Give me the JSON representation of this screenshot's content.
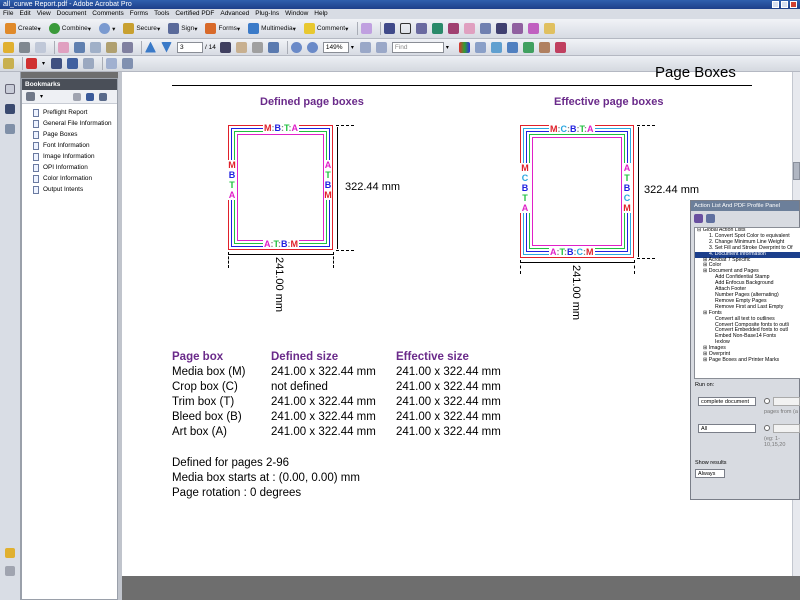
{
  "window": {
    "title": "all_curwe Report.pdf - Adobe Acrobat Pro"
  },
  "menu": [
    "File",
    "Edit",
    "View",
    "Document",
    "Comments",
    "Forms",
    "Tools",
    "Certified PDF",
    "Advanced",
    "Plug-Ins",
    "Window",
    "Help"
  ],
  "toolbar": {
    "create": "Create",
    "combine": "Combine",
    "secure": "Secure",
    "sign": "Sign",
    "forms": "Forms",
    "multimedia": "Multimedia",
    "comment": "Comment",
    "page_number": "3",
    "page_total": "/ 14",
    "zoom": "149%",
    "find_placeholder": "Find"
  },
  "bookmarks": {
    "title": "Bookmarks",
    "items": [
      "Preflight Report",
      "General File Information",
      "Page Boxes",
      "Font Information",
      "Image Information",
      "OPI Information",
      "Color Information",
      "Output Intents"
    ]
  },
  "page": {
    "heading": "Page Boxes",
    "defined_caption": "Defined page boxes",
    "effective_caption": "Effective page boxes",
    "height_dim": "322.44 mm",
    "width_dim": "241.00 mm",
    "defined_top_labels": [
      "M",
      "B",
      "T",
      "A"
    ],
    "defined_left_labels": [
      "M",
      "B",
      "T",
      "A"
    ],
    "effective_top_labels": [
      "M",
      "C",
      "B",
      "T",
      "A"
    ],
    "effective_left_labels": [
      "M",
      "C",
      "B",
      "T",
      "A"
    ],
    "table_headers": [
      "Page box",
      "Defined size",
      "Effective size"
    ],
    "table_rows": [
      [
        "Media box (M)",
        "241.00 x 322.44 mm",
        "241.00 x 322.44 mm"
      ],
      [
        "Crop box (C)",
        "not defined",
        "241.00 x 322.44 mm"
      ],
      [
        "Trim box (T)",
        "241.00 x 322.44 mm",
        "241.00 x 322.44 mm"
      ],
      [
        "Bleed box (B)",
        "241.00 x 322.44 mm",
        "241.00 x 322.44 mm"
      ],
      [
        "Art box (A)",
        "241.00 x 322.44 mm",
        "241.00 x 322.44 mm"
      ]
    ],
    "notes": [
      "Defined for pages 2-96",
      "Media box starts at : (0.00, 0.00) mm",
      "Page rotation : 0 degrees"
    ]
  },
  "colors": {
    "media": "#e0202a",
    "crop": "#2aa7e0",
    "bleed": "#2020e0",
    "trim": "#20c040",
    "art": "#e020c8",
    "caption": "#6a2a8a"
  },
  "action_panel": {
    "title": "Action List And PDF Profile Panel",
    "tree": [
      {
        "text": "Global Action Lists",
        "indent": 0
      },
      {
        "text": "1. Convert Spot Color to equivalent",
        "indent": 2
      },
      {
        "text": "2. Change Minimum Line Weight",
        "indent": 2
      },
      {
        "text": "3. Set Fill and Stroke Overprint to Of",
        "indent": 2
      },
      {
        "text": "4. Document Information",
        "indent": 2,
        "selected": true
      },
      {
        "text": "Acrobat 7 Specific",
        "indent": 1
      },
      {
        "text": "Color",
        "indent": 1
      },
      {
        "text": "Document and Pages",
        "indent": 1
      },
      {
        "text": "Add Confidential Stamp",
        "indent": 3
      },
      {
        "text": "Add Enfocus Background",
        "indent": 3
      },
      {
        "text": "Attach Footer",
        "indent": 3
      },
      {
        "text": "Number Pages  (alternating)",
        "indent": 3
      },
      {
        "text": "Remove Empty Pages",
        "indent": 3
      },
      {
        "text": "Remove First and Last Empty",
        "indent": 3
      },
      {
        "text": "Fonts",
        "indent": 1
      },
      {
        "text": "Convert all text to outlines",
        "indent": 3
      },
      {
        "text": "Convert Composite fonts to outli",
        "indent": 3
      },
      {
        "text": "Convert Embedded fonts to outl",
        "indent": 3
      },
      {
        "text": "Embed Non-Base14 Fonts",
        "indent": 3
      },
      {
        "text": "Iexlow",
        "indent": 3
      },
      {
        "text": "Images",
        "indent": 1
      },
      {
        "text": "Overprint",
        "indent": 1
      },
      {
        "text": "Page Boxes and Printer Marks",
        "indent": 1
      }
    ],
    "run_on": "Run on:",
    "run_on_value": "complete document",
    "pages_value": "All",
    "pages_from": "pages from (a",
    "range_hint": "(eg: 1-10,15,20",
    "show_results": "Show results",
    "show_results_value": "Always"
  }
}
